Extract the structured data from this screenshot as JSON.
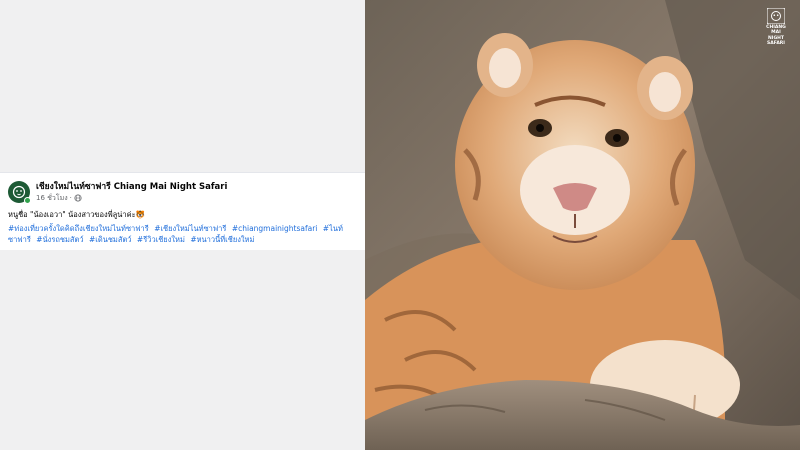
{
  "post": {
    "page_name": "เชียงใหม่ไนท์ซาฟารี Chiang Mai Night Safari",
    "time_ago": "16 ชั่วโมง",
    "separator": "·",
    "text": "หนูชื่อ \"น้องเอวา\" น้องสาวของพี่ลูน่าค่ะ🐯",
    "hashtags": [
      "#ท่องเที่ยวครั้งใดคิดถึงเชียงใหม่ไนท์ซาฟารี",
      "#เชียงใหม่ไนท์ซาฟารี",
      "#chiangmainightsafari",
      "#ไนท์ซาฟารี",
      "#นั่งรถชมสัตว์",
      "#เดินชมสัตว์",
      "#รีวิวเชียงใหม่",
      "#หนาวนี้ที่เชียงใหม่"
    ]
  },
  "photo": {
    "logo_line1": "CHIANG MAI",
    "logo_line2": "NIGHT SAFARI"
  },
  "colors": {
    "accent": "#216fdb",
    "avatar": "#1d5a35"
  }
}
